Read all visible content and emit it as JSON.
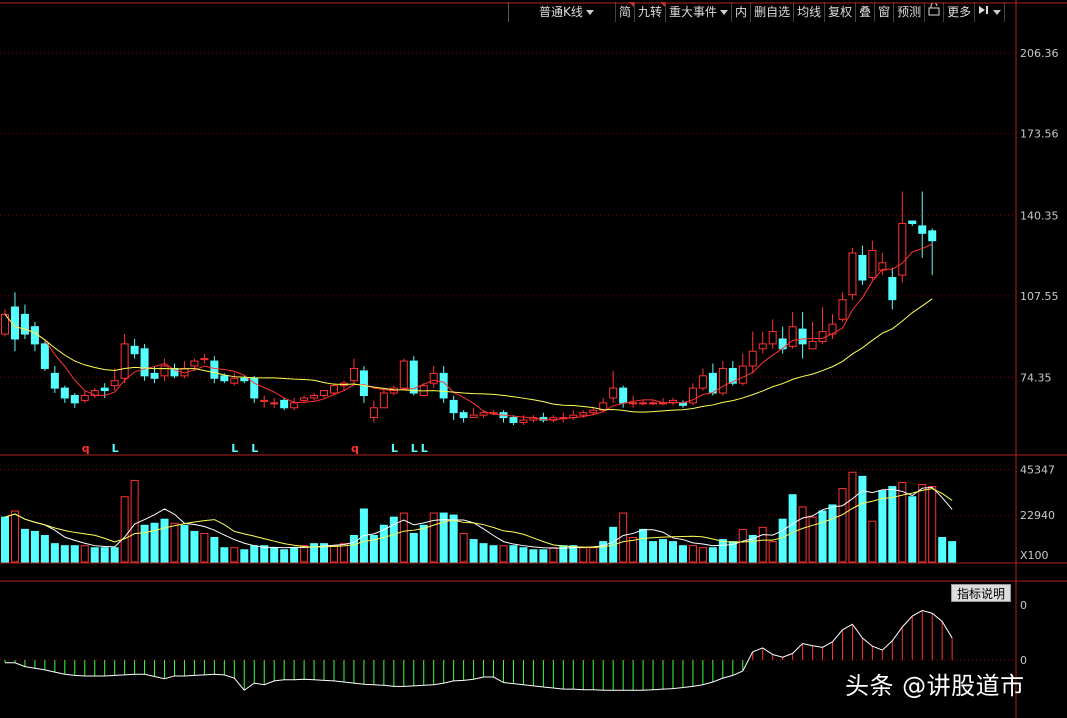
{
  "toolbar": {
    "items": [
      {
        "label": "普通K线",
        "dropdown": true,
        "wide": true
      },
      {
        "label": "简",
        "mark": true
      },
      {
        "label": "九转",
        "mark": true
      },
      {
        "label": "重大事件",
        "dropdown": true
      },
      {
        "label": "内"
      },
      {
        "label": "删自选"
      },
      {
        "label": "均线"
      },
      {
        "label": "复权"
      },
      {
        "label": "叠"
      },
      {
        "label": "窗"
      },
      {
        "label": "预测"
      },
      {
        "label": "lock-icon",
        "icon": true
      },
      {
        "label": "更多"
      },
      {
        "label": "pin-icon",
        "icon": true,
        "dropdown": true
      }
    ]
  },
  "indicator_button": "指标说明",
  "watermark": "头条 @讲股道市",
  "colors": {
    "up": "#ff3232",
    "down": "#54ffff",
    "ma_short": "#ff3232",
    "ma_long": "#ffff54",
    "grid": "#8b0000",
    "bg": "#000000"
  },
  "chart_data": [
    {
      "type": "candlestick",
      "title": "",
      "ylim": [
        44,
        219
      ],
      "yticks": [
        "206.36",
        "173.56",
        "140.35",
        "107.55",
        "74.35"
      ],
      "ytick_values": [
        206.36,
        173.56,
        140.35,
        107.55,
        74.35
      ],
      "markers": [
        {
          "index": 8,
          "text": "q"
        },
        {
          "index": 11,
          "text": "L"
        },
        {
          "index": 23,
          "text": "L"
        },
        {
          "index": 25,
          "text": "L"
        },
        {
          "index": 35,
          "text": "q"
        },
        {
          "index": 39,
          "text": "L"
        },
        {
          "index": 41,
          "text": "L"
        },
        {
          "index": 42,
          "text": "L"
        }
      ],
      "candles": [
        [
          92,
          100,
          91,
          102
        ],
        [
          103,
          90,
          85,
          109
        ],
        [
          100,
          92,
          90,
          104
        ],
        [
          95,
          88,
          85,
          97
        ],
        [
          88,
          78,
          77,
          89
        ],
        [
          76,
          70,
          68,
          79
        ],
        [
          70,
          66,
          64,
          71
        ],
        [
          67,
          64,
          62,
          68
        ],
        [
          65,
          67,
          64,
          69
        ],
        [
          67,
          69,
          66,
          70
        ],
        [
          70,
          69,
          66,
          72
        ],
        [
          71,
          73,
          69,
          78
        ],
        [
          74,
          88,
          72,
          92
        ],
        [
          87,
          84,
          82,
          90
        ],
        [
          86,
          75,
          73,
          88
        ],
        [
          76,
          74,
          72,
          79
        ],
        [
          75,
          79,
          73,
          82
        ],
        [
          78,
          75,
          74,
          80
        ],
        [
          75,
          78,
          74,
          81
        ],
        [
          79,
          81,
          77,
          82
        ],
        [
          82,
          82,
          80,
          84
        ],
        [
          81,
          74,
          72,
          83
        ],
        [
          75,
          73,
          72,
          76
        ],
        [
          72,
          74,
          71,
          76
        ],
        [
          74,
          73,
          72,
          75
        ],
        [
          74,
          66,
          64,
          75
        ],
        [
          65,
          65,
          62,
          67
        ],
        [
          64,
          64,
          62,
          66
        ],
        [
          65,
          62,
          61,
          66
        ],
        [
          62,
          64,
          61,
          66
        ],
        [
          65,
          66,
          64,
          67
        ],
        [
          66,
          67,
          65,
          68
        ],
        [
          67,
          69,
          66,
          69
        ],
        [
          68,
          71,
          67,
          72
        ],
        [
          71,
          72,
          69,
          73
        ],
        [
          73,
          78,
          71,
          82
        ],
        [
          77,
          67,
          64,
          79
        ],
        [
          58,
          62,
          56,
          65
        ],
        [
          62,
          68,
          62,
          70
        ],
        [
          68,
          70,
          67,
          71
        ],
        [
          70,
          81,
          69,
          82
        ],
        [
          81,
          68,
          67,
          83
        ],
        [
          67,
          71,
          67,
          72
        ],
        [
          72,
          76,
          70,
          79
        ],
        [
          76,
          66,
          64,
          79
        ],
        [
          65,
          60,
          57,
          67
        ],
        [
          60,
          58,
          56,
          61
        ],
        [
          58,
          59,
          58,
          62
        ],
        [
          59,
          60,
          58,
          61
        ],
        [
          60,
          60,
          59,
          61
        ],
        [
          60,
          58,
          56,
          61
        ],
        [
          58,
          56,
          55,
          59
        ],
        [
          56,
          57,
          55,
          59
        ],
        [
          57,
          58,
          56,
          59
        ],
        [
          58,
          57,
          56,
          60
        ],
        [
          57,
          58,
          56,
          59
        ],
        [
          58,
          58,
          56,
          60
        ],
        [
          58,
          59,
          57,
          61
        ],
        [
          59,
          60,
          58,
          61
        ],
        [
          60,
          61,
          59,
          62
        ],
        [
          61,
          64,
          60,
          66
        ],
        [
          66,
          70,
          64,
          77
        ],
        [
          70,
          64,
          62,
          71
        ],
        [
          64,
          64,
          62,
          67
        ],
        [
          64,
          64,
          63,
          65
        ],
        [
          64,
          64,
          63,
          65
        ],
        [
          64,
          64,
          63,
          66
        ],
        [
          64,
          65,
          63,
          66
        ],
        [
          64,
          63,
          62,
          65
        ],
        [
          64,
          70,
          63,
          72
        ],
        [
          70,
          75,
          69,
          78
        ],
        [
          76,
          68,
          67,
          80
        ],
        [
          68,
          78,
          67,
          81
        ],
        [
          78,
          72,
          71,
          81
        ],
        [
          72,
          79,
          71,
          84
        ],
        [
          79,
          85,
          76,
          93
        ],
        [
          86,
          88,
          84,
          93
        ],
        [
          88,
          93,
          86,
          98
        ],
        [
          90,
          86,
          84,
          95
        ],
        [
          87,
          95,
          86,
          101
        ],
        [
          94,
          88,
          82,
          101
        ],
        [
          86,
          89,
          86,
          97
        ],
        [
          89,
          93,
          88,
          103
        ],
        [
          92,
          96,
          90,
          100
        ],
        [
          98,
          106,
          97,
          109
        ],
        [
          108,
          125,
          106,
          127
        ],
        [
          124,
          114,
          112,
          128
        ],
        [
          115,
          126,
          114,
          130
        ],
        [
          118,
          121,
          116,
          125
        ],
        [
          115,
          106,
          102,
          119
        ],
        [
          116,
          137,
          113,
          150
        ],
        [
          138,
          137,
          136,
          138
        ],
        [
          136,
          133,
          123,
          150
        ],
        [
          134,
          130,
          116,
          135
        ]
      ]
    },
    {
      "type": "bar",
      "title": "",
      "ylim": [
        0,
        51000
      ],
      "yticks": [
        "45347",
        "22940",
        "X100"
      ],
      "ytick_values": [
        45347,
        22940,
        0
      ],
      "values": [
        22000,
        25000,
        16000,
        15000,
        13000,
        9000,
        8000,
        8000,
        8000,
        7000,
        7000,
        7000,
        32000,
        40000,
        18000,
        19000,
        21000,
        19000,
        18000,
        15000,
        14000,
        12000,
        7000,
        7000,
        6000,
        8000,
        8000,
        7000,
        6000,
        7000,
        8000,
        9000,
        9000,
        8000,
        9000,
        13000,
        26000,
        13000,
        18000,
        22000,
        24000,
        14000,
        18000,
        24000,
        24000,
        23000,
        14000,
        11000,
        9000,
        8000,
        8000,
        8000,
        7000,
        6000,
        6000,
        7000,
        8000,
        8000,
        7000,
        7000,
        10000,
        17000,
        24000,
        12000,
        16000,
        10000,
        11000,
        10000,
        8000,
        8000,
        7000,
        7000,
        11000,
        10000,
        16000,
        13000,
        17000,
        10000,
        21000,
        33000,
        27000,
        22000,
        25000,
        28000,
        36000,
        44000,
        42000,
        20000,
        35000,
        37000,
        39000,
        32000,
        38000,
        37000,
        12000,
        10000
      ],
      "directions": "dudddddduddduuddduddudduddddddudduuddddduddudduddduddddudduudduuddddduuddduduudduudduududduduud",
      "ma_short": [],
      "ma_long": []
    },
    {
      "type": "bar",
      "title": "",
      "ylim": [
        -1,
        0.2
      ],
      "yticks": [
        "0",
        "0"
      ],
      "values": [
        -0.05,
        -0.05,
        -0.12,
        -0.15,
        -0.18,
        -0.22,
        -0.26,
        -0.28,
        -0.29,
        -0.29,
        -0.29,
        -0.28,
        -0.27,
        -0.26,
        -0.26,
        -0.3,
        -0.34,
        -0.29,
        -0.29,
        -0.28,
        -0.27,
        -0.26,
        -0.27,
        -0.33,
        -0.55,
        -0.42,
        -0.45,
        -0.38,
        -0.36,
        -0.36,
        -0.35,
        -0.36,
        -0.37,
        -0.38,
        -0.4,
        -0.42,
        -0.44,
        -0.45,
        -0.46,
        -0.48,
        -0.48,
        -0.47,
        -0.46,
        -0.45,
        -0.42,
        -0.38,
        -0.37,
        -0.35,
        -0.31,
        -0.31,
        -0.41,
        -0.43,
        -0.45,
        -0.47,
        -0.49,
        -0.51,
        -0.53,
        -0.53,
        -0.54,
        -0.54,
        -0.55,
        -0.55,
        -0.55,
        -0.55,
        -0.55,
        -0.54,
        -0.53,
        -0.52,
        -0.5,
        -0.48,
        -0.45,
        -0.4,
        -0.33,
        -0.28,
        -0.2,
        0.15,
        0.22,
        0.1,
        0.05,
        0.12,
        0.3,
        0.26,
        0.23,
        0.33,
        0.55,
        0.65,
        0.4,
        0.25,
        0.18,
        0.35,
        0.6,
        0.8,
        0.9,
        0.85,
        0.7,
        0.4
      ]
    }
  ]
}
